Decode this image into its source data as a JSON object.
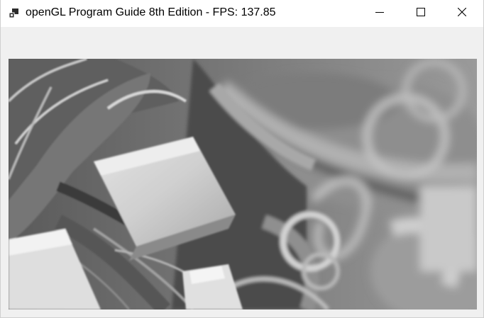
{
  "window": {
    "title": "openGL Program Guide 8th Edition - FPS: 137.85",
    "icon": "app-icon"
  },
  "controls": {
    "minimize_icon": "minimize-icon",
    "maximize_icon": "maximize-icon",
    "close_icon": "close-icon"
  },
  "viewport": {
    "content": "grayscale-food-texture-render"
  }
}
